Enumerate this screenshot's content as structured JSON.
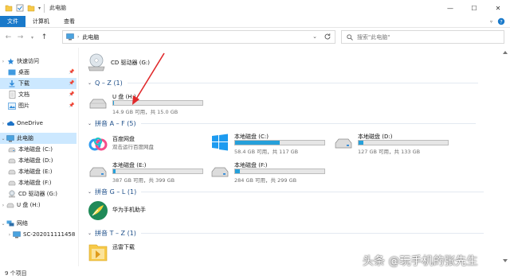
{
  "window": {
    "title": "此电脑",
    "controls": {
      "minimize": "—",
      "maximize": "☐",
      "close": "✕"
    }
  },
  "ribbon": {
    "tabs": [
      "文件",
      "计算机",
      "查看"
    ]
  },
  "address": {
    "crumb": "此电脑",
    "search_placeholder": "搜索\"此电脑\""
  },
  "sidebar": {
    "items": [
      {
        "label": "快速访问",
        "icon": "star-icon",
        "pinned": false
      },
      {
        "label": "桌面",
        "icon": "desktop-folder-icon",
        "pinned": true
      },
      {
        "label": "下载",
        "icon": "download-folder-icon",
        "pinned": true
      },
      {
        "label": "文档",
        "icon": "documents-folder-icon",
        "pinned": true
      },
      {
        "label": "图片",
        "icon": "pictures-folder-icon",
        "pinned": true
      },
      {
        "label": "OneDrive",
        "icon": "cloud-icon",
        "pinned": false
      },
      {
        "label": "此电脑",
        "icon": "computer-icon",
        "pinned": false
      },
      {
        "label": "本地磁盘 (C:)",
        "icon": "drive-icon",
        "pinned": false
      },
      {
        "label": "本地磁盘 (D:)",
        "icon": "drive-icon",
        "pinned": false
      },
      {
        "label": "本地磁盘 (E:)",
        "icon": "drive-icon",
        "pinned": false
      },
      {
        "label": "本地磁盘 (F:)",
        "icon": "drive-icon",
        "pinned": false
      },
      {
        "label": "CD 驱动器 (G:)",
        "icon": "cd-drive-icon",
        "pinned": false
      },
      {
        "label": "U 盘 (H:)",
        "icon": "usb-drive-icon",
        "pinned": false
      },
      {
        "label": "网络",
        "icon": "network-icon",
        "pinned": false
      },
      {
        "label": "SC-202011111458",
        "icon": "network-computer-icon",
        "pinned": false
      }
    ]
  },
  "groups": {
    "qz": "Q – Z (1)",
    "af": "拼音 A – F (5)",
    "gl": "拼音 G – L (1)",
    "tz": "拼音 T – Z (1)"
  },
  "items": {
    "cd": {
      "name": "CD 驱动器 (G:)"
    },
    "usb": {
      "name": "U 盘 (H:)",
      "cap": "14.9 GB 可用，共 15.0 GB",
      "used_fraction": 0.01
    },
    "baidu": {
      "name": "百度网盘",
      "sub": "双击运行百度网盘"
    },
    "c": {
      "name": "本地磁盘 (C:)",
      "cap": "58.4 GB 可用，共 117 GB",
      "used_fraction": 0.5
    },
    "d": {
      "name": "本地磁盘 (D:)",
      "cap": "127 GB 可用，共 133 GB",
      "used_fraction": 0.05
    },
    "e": {
      "name": "本地磁盘 (E:)",
      "cap": "387 GB 可用，共 399 GB",
      "used_fraction": 0.03
    },
    "f": {
      "name": "本地磁盘 (F:)",
      "cap": "284 GB 可用，共 299 GB",
      "used_fraction": 0.05
    },
    "huawei": {
      "name": "华为手机助手"
    },
    "xunlei": {
      "name": "迅雷下载"
    }
  },
  "status": {
    "count": "9 个项目"
  },
  "watermark": "头条 @玩手机的张先生",
  "colors": {
    "accent": "#1979ca",
    "selection": "#cce8ff",
    "bar_fill": "#26a0da",
    "group_text": "#1d4e89"
  }
}
